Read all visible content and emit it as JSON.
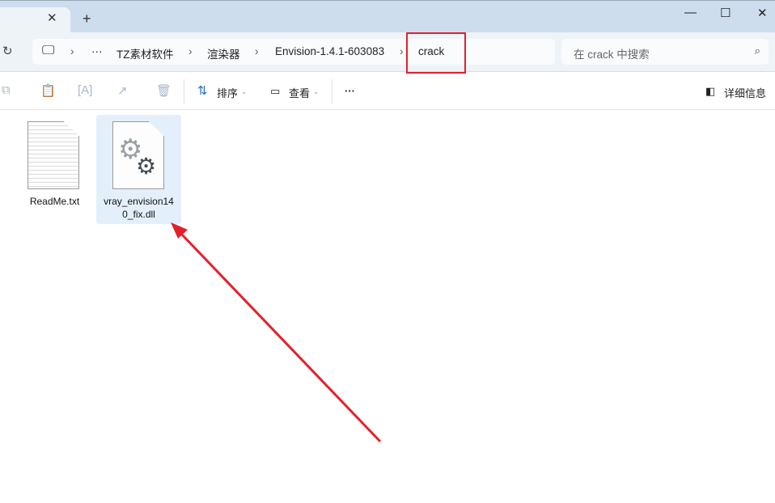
{
  "titlebar": {
    "new_tab": "+",
    "close_tab": "✕",
    "minimize": "—",
    "maximize": "☐",
    "close": "✕"
  },
  "address": {
    "more": "···",
    "crumbs": [
      "TZ素材软件",
      "渲染器",
      "Envision-1.4.1-603083",
      "crack"
    ]
  },
  "search": {
    "placeholder": "在 crack 中搜索"
  },
  "toolbar": {
    "sort": "排序",
    "view": "查看",
    "more": "···",
    "details": "详细信息"
  },
  "files": [
    {
      "name": "ReadMe.txt"
    },
    {
      "name": "vray_envision140_fix.dll",
      "line1": "vray_envision14",
      "line2": "0_fix.dll"
    }
  ],
  "annotation": {
    "color": "#e3202a"
  }
}
